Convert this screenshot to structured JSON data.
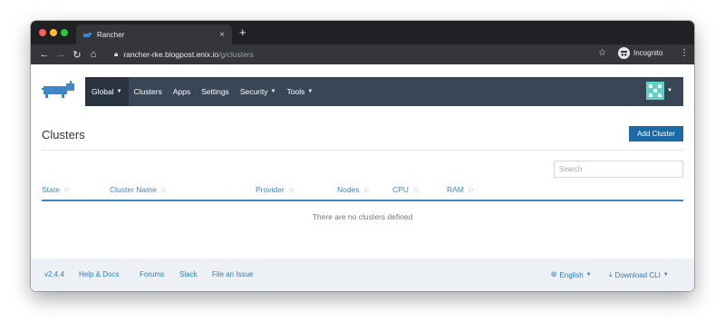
{
  "browser": {
    "tab_title": "Rancher",
    "tab_close": "×",
    "new_tab": "+",
    "url_host": "rancher-rke.blogpost.enix.io",
    "url_path": "/g/clusters",
    "incognito_label": "Incognito"
  },
  "nav": {
    "items": [
      {
        "label": "Global"
      },
      {
        "label": "Clusters"
      },
      {
        "label": "Apps"
      },
      {
        "label": "Settings"
      },
      {
        "label": "Security"
      },
      {
        "label": "Tools"
      }
    ]
  },
  "main": {
    "title": "Clusters",
    "add_button": "Add Cluster",
    "search_placeholder": "Search",
    "columns": [
      {
        "label": "State"
      },
      {
        "label": "Cluster Name"
      },
      {
        "label": "Provider"
      },
      {
        "label": "Nodes"
      },
      {
        "label": "CPU"
      },
      {
        "label": "RAM"
      }
    ],
    "empty_message": "There are no clusters defined"
  },
  "footer": {
    "version": "v2.4.4",
    "links": [
      "Help & Docs",
      "Forums",
      "Slack",
      "File an Issue"
    ],
    "language": "English",
    "download": "Download CLI"
  },
  "colors": {
    "nav_bg": "#384657",
    "accent": "#3d87c6",
    "primary_button": "#1c6aa5"
  }
}
